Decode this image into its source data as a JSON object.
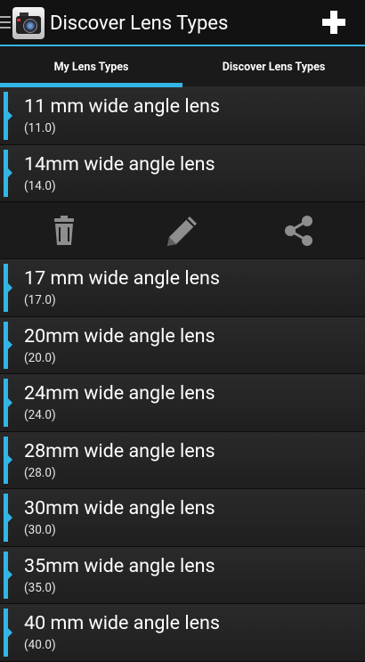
{
  "app": {
    "title": "Discover Lens Types"
  },
  "tabs": [
    {
      "label": "My Lens Types",
      "selected": true
    },
    {
      "label": "Discover Lens Types",
      "selected": false
    }
  ],
  "lenses": [
    {
      "name": "11 mm wide angle lens",
      "value": "(11.0)"
    },
    {
      "name": "14mm wide angle lens",
      "value": "(14.0)"
    },
    {
      "name": "17 mm wide angle lens",
      "value": "(17.0)"
    },
    {
      "name": "20mm wide angle lens",
      "value": "(20.0)"
    },
    {
      "name": "24mm wide angle lens",
      "value": "(24.0)"
    },
    {
      "name": "28mm wide angle lens",
      "value": "(28.0)"
    },
    {
      "name": "30mm wide angle lens",
      "value": "(30.0)"
    },
    {
      "name": "35mm wide angle lens",
      "value": "(35.0)"
    },
    {
      "name": "40 mm wide angle lens",
      "value": "(40.0)"
    }
  ],
  "item_actions": [
    {
      "icon": "trash-icon"
    },
    {
      "icon": "pencil-icon"
    },
    {
      "icon": "share-icon"
    }
  ],
  "colors": {
    "accent": "#33b5e5",
    "background": "#1e1e1e",
    "actionbar": "#121212",
    "icon_gray": "#8e8e8e"
  }
}
